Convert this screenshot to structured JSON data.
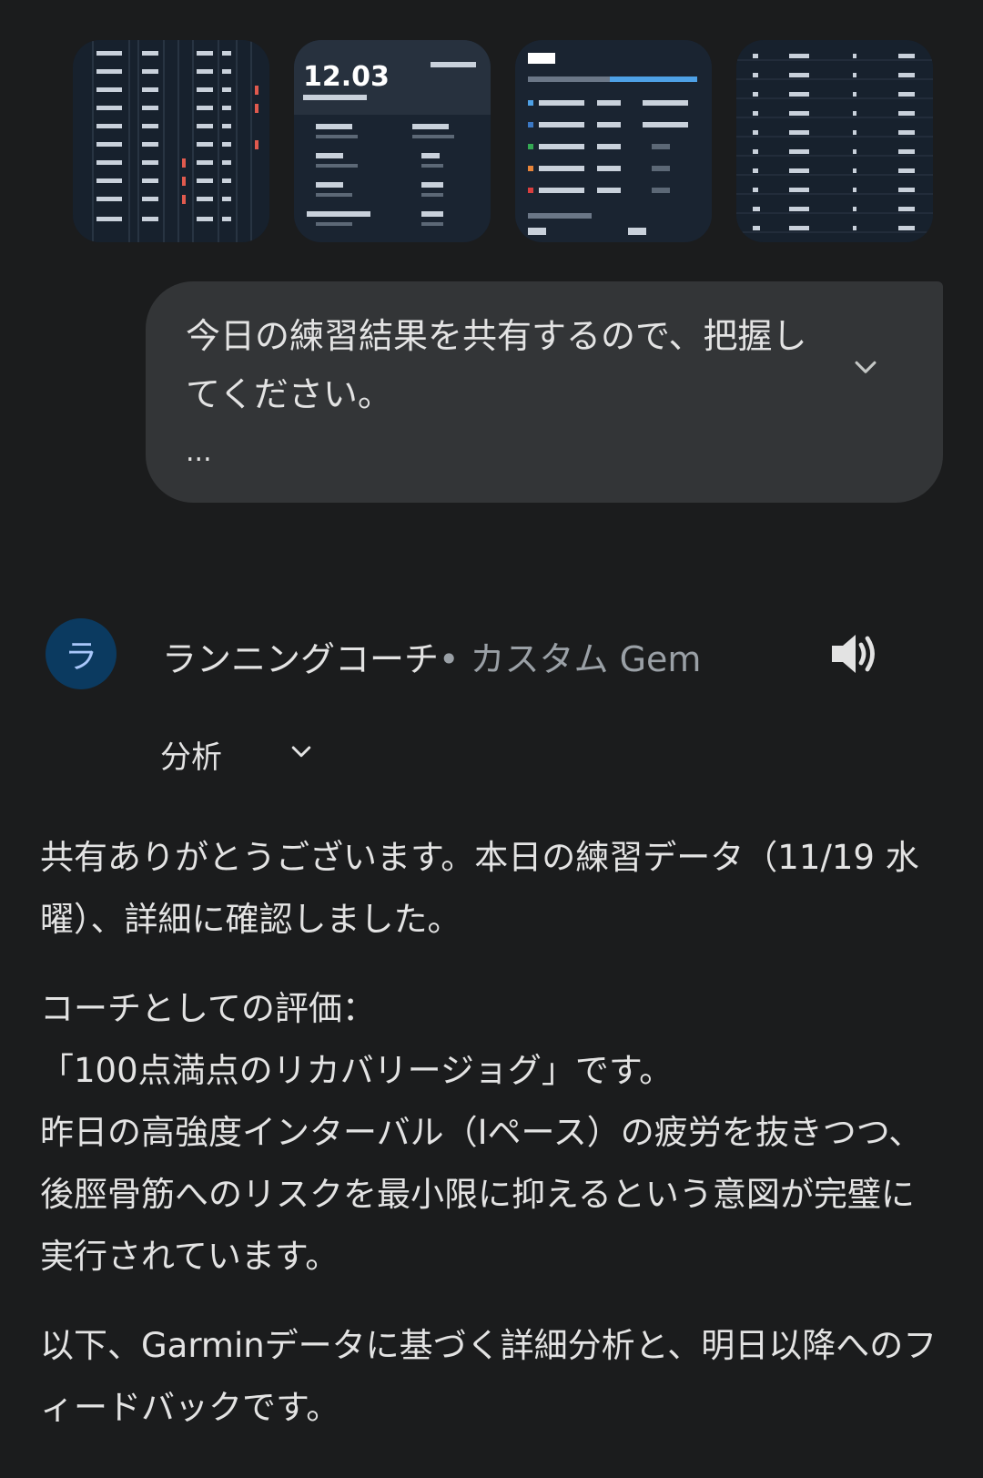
{
  "attachments": {
    "thumbnails": [
      {
        "label": "lap-table-screenshot-1"
      },
      {
        "label": "activity-summary-screenshot",
        "headline": "12.03"
      },
      {
        "label": "heart-rate-zones-screenshot"
      },
      {
        "label": "lap-table-screenshot-2"
      }
    ]
  },
  "user_message": {
    "text": "今日の練習結果を共有するので、把握し\nてください。",
    "more": "..."
  },
  "gem": {
    "avatar_letter": "ラ",
    "name": "ランニングコーチ",
    "separator": "• ",
    "type": "カスタム Gem"
  },
  "analysis": {
    "label": "分析"
  },
  "response": {
    "p1": "共有ありがとうございます。本日の練習データ（11/19 水\n曜）、詳細に確認しました。",
    "p2": "コーチとしての評価：\n「100点満点のリカバリージョグ」です。\n昨日の高強度インターバル（Iペース）の疲労を抜きつつ、\n後脛骨筋へのリスクを最小限に抑えるという意図が完璧に\n実行されています。",
    "p3": "以下、Garminデータに基づく詳細分析と、明日以降へのフ\nィードバックです。"
  },
  "colors": {
    "background": "#1b1c1d",
    "bubble": "#333537",
    "avatar_bg": "#0b3a60",
    "avatar_fg": "#a8c7fa",
    "muted": "#9aa0a6"
  }
}
